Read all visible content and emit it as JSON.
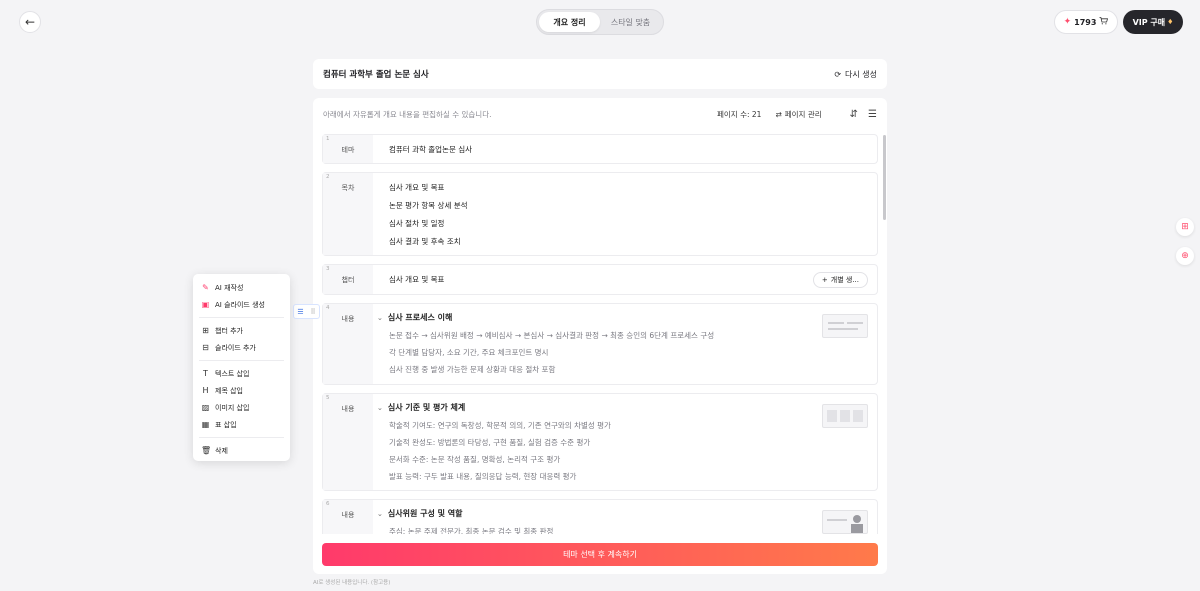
{
  "header": {
    "tabs": [
      {
        "label": "개요 정리"
      },
      {
        "label": "스타일 맞춤"
      }
    ],
    "credits": "1793",
    "vip_label": "VIP 구매"
  },
  "title_card": {
    "title": "컴퓨터 과학부 졸업 논문 심사",
    "regen_label": "다시 생성"
  },
  "editor": {
    "hint": "아래에서 자유롭게 개요 내용을 편집하실 수 있습니다.",
    "page_count": "페이지 수: 21",
    "manage_label": "페이지 관리"
  },
  "rows": [
    {
      "num": "1",
      "label": "테마",
      "text": "컴퓨터 과학 졸업논문 심사"
    },
    {
      "num": "2",
      "label": "목차",
      "items": [
        "심사 개요 및 목표",
        "논문 평가 항목 상세 분석",
        "심사 절차 및 일정",
        "심사 결과 및 후속 조치"
      ]
    },
    {
      "num": "3",
      "label": "챕터",
      "text": "심사 개요 및 목표",
      "button": "개별 생..."
    },
    {
      "num": "4",
      "label": "내용",
      "heading": "심사 프로세스 이해",
      "lines": [
        "논문 접수 → 심사위원 배정 → 예비심사 → 본심사 → 심사결과 판정 → 최종 승인의 6단계 프로세스 구성",
        "각 단계별 담당자, 소요 기간, 주요 체크포인트 명시",
        "심사 진행 중 발생 가능한 문제 상황과 대응 절차 포함"
      ]
    },
    {
      "num": "5",
      "label": "내용",
      "heading": "심사 기준 및 평가 체계",
      "lines": [
        "학술적 기여도: 연구의 독창성, 학문적 의의, 기존 연구와의 차별성 평가",
        "기술적 완성도: 방법론의 타당성, 구현 품질, 실험 검증 수준 평가",
        "문서화 수준: 논문 작성 품질, 명확성, 논리적 구조 평가",
        "발표 능력: 구두 발표 내용, 질의응답 능력, 현장 대응력 평가"
      ]
    },
    {
      "num": "6",
      "label": "내용",
      "heading": "심사위원 구성 및 역할",
      "lines": [
        "주심: 논문 주제 전문가, 최종 논문 검수 및 최종 판정"
      ]
    }
  ],
  "cta_label": "테마 선택 후 계속하기",
  "footnote": "AI로 생성된 내용입니다. (참고용)",
  "context_menu": {
    "items": [
      "AI 재작성",
      "AI 슬라이드 생성",
      "챕터 추가",
      "슬라이드 추가",
      "텍스트 삽입",
      "제목 삽입",
      "이미지 삽입",
      "표 삽입",
      "삭제"
    ]
  },
  "colors": {
    "accent_start": "#ff3a6b",
    "accent_end": "#ff7a4a",
    "vip_bg": "#26262b"
  }
}
